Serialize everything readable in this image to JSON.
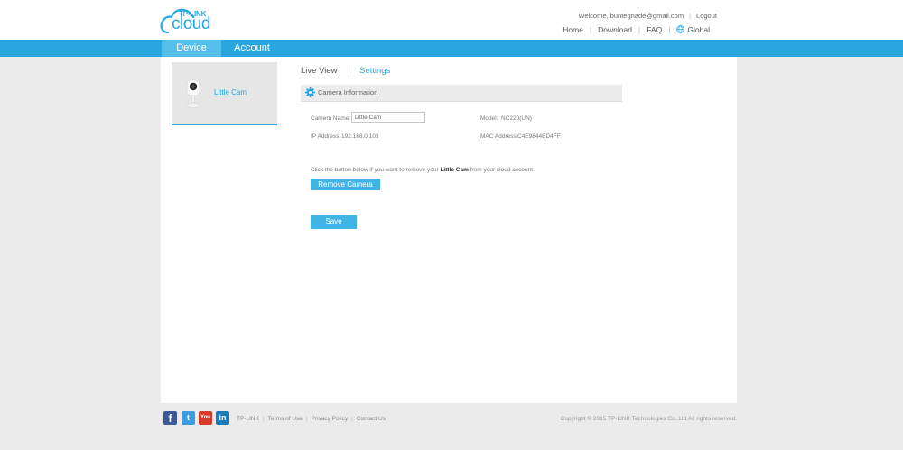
{
  "header": {
    "logo_brand": "TP-LINK",
    "logo_word": "cloud",
    "welcome": "Welcome, buntegnade@gmail.com",
    "logout": "Logout",
    "links": {
      "home": "Home",
      "download": "Download",
      "faq": "FAQ",
      "global": "Global"
    }
  },
  "nav": {
    "device": "Device",
    "account": "Account"
  },
  "device_list": [
    {
      "name": "Little Cam"
    }
  ],
  "subtabs": {
    "live_view": "Live View",
    "settings": "Settings"
  },
  "camera_info": {
    "section_title": "Camera Information",
    "camera_name_label": "Camera Name:",
    "camera_name_value": "Little Cam",
    "model_label": "Model:",
    "model_value": "NC220(UN)",
    "ip_label": "IP Address:",
    "ip_value": "192.168.0.103",
    "mac_label": "MAC Address:",
    "mac_value": "C4E9844ED4FF"
  },
  "remove": {
    "text_before": "Click the button below if you want to remove your ",
    "device_name": "Little Cam",
    "text_after": " from your cloud account.",
    "button": "Remove Camera"
  },
  "save_button": "Save",
  "footer": {
    "social": {
      "facebook": "f",
      "twitter": "t",
      "youtube": "You",
      "linkedin": "in"
    },
    "links": {
      "tplink": "TP-LINK",
      "terms": "Terms of Use",
      "privacy": "Privacy Policy",
      "contact": "Contact Us"
    },
    "copyright": "Copyright © 2015 TP-LINK Technologies Co.,Ltd.All rights reserved."
  },
  "colors": {
    "accent": "#2aa6df",
    "accent_light": "#55c0ec",
    "button": "#41b4e6",
    "background": "#ebebeb"
  },
  "icons": {
    "logo": "cloud-logo-icon",
    "globe": "globe-icon",
    "camera": "camera-device-icon",
    "gear": "gear-icon"
  }
}
